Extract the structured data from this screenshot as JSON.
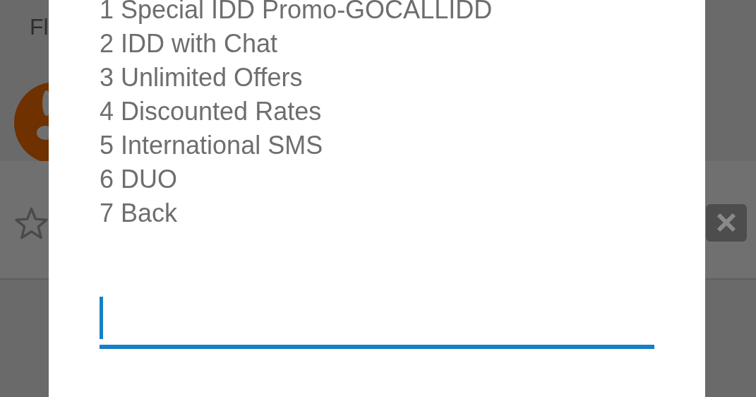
{
  "background": {
    "title": "Fl"
  },
  "dialog": {
    "options": [
      "1 Special IDD Promo-GOCALLIDD",
      "2 IDD with Chat",
      "3 Unlimited Offers",
      "4 Discounted Rates",
      "5 International SMS",
      "6 DUO",
      "7 Back"
    ]
  }
}
